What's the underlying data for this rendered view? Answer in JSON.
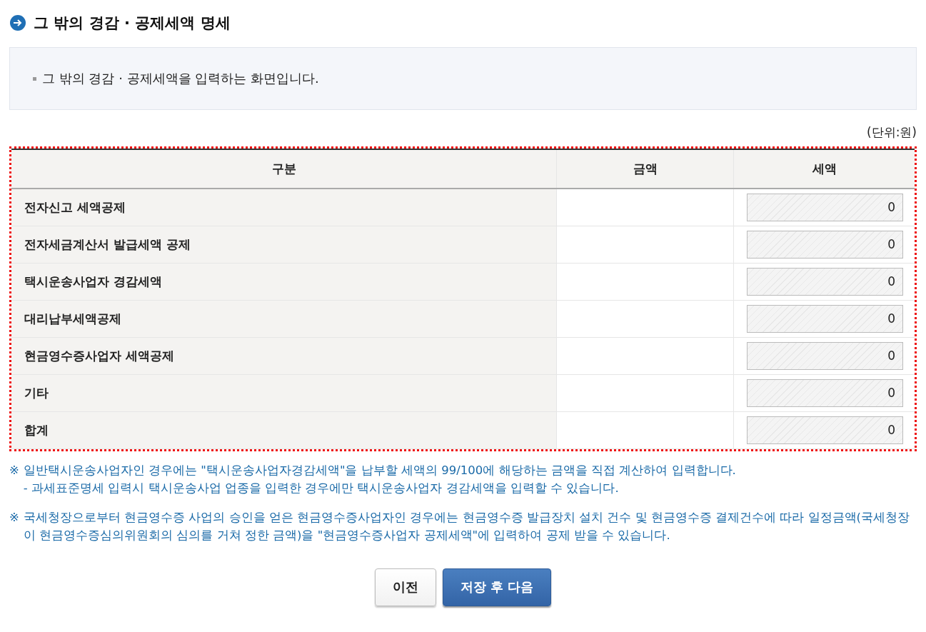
{
  "title": "그 밖의 경감 · 공제세액 명세",
  "info": {
    "text": "그 밖의 경감 · 공제세액을 입력하는 화면입니다."
  },
  "unit": "(단위:원)",
  "table": {
    "columns": [
      "구분",
      "금액",
      "세액"
    ],
    "rows": [
      {
        "label": "전자신고 세액공제",
        "tax": "0",
        "disabled": true
      },
      {
        "label": "전자세금계산서 발급세액 공제",
        "tax": "0",
        "disabled": true
      },
      {
        "label": "택시운송사업자 경감세액",
        "tax": "0",
        "disabled": true
      },
      {
        "label": "대리납부세액공제",
        "tax": "0",
        "disabled": true
      },
      {
        "label": "현금영수증사업자 세액공제",
        "tax": "0",
        "disabled": true
      },
      {
        "label": "기타",
        "tax": "0",
        "disabled": true
      },
      {
        "label": "합계",
        "tax": "0",
        "disabled": true
      }
    ]
  },
  "notes": [
    {
      "mark": "※",
      "text": "일반택시운송사업자인 경우에는 \"택시운송사업자경감세액\"을 납부할 세액의 99/100에 해당하는 금액을 직접 계산하여 입력합니다.",
      "sub": "- 과세표준명세 입력시 택시운송사업 업종을 입력한 경우에만 택시운송사업자 경감세액을 입력할 수 있습니다."
    },
    {
      "mark": "※",
      "text": "국세청장으로부터 현금영수증 사업의 승인을 얻은 현금영수증사업자인 경우에는 현금영수증 발급장치 설치 건수 및 현금영수증 결제건수에 따라 일정금액(국세청장이 현금영수증심의위원회의 심의를 거쳐 정한 금액)을 \"현금영수증사업자 공제세액\"에 입력하여 공제 받을 수 있습니다."
    }
  ],
  "buttons": [
    {
      "label": "이전",
      "kind": "secondary"
    },
    {
      "label": "저장 후 다음",
      "kind": "primary"
    }
  ]
}
